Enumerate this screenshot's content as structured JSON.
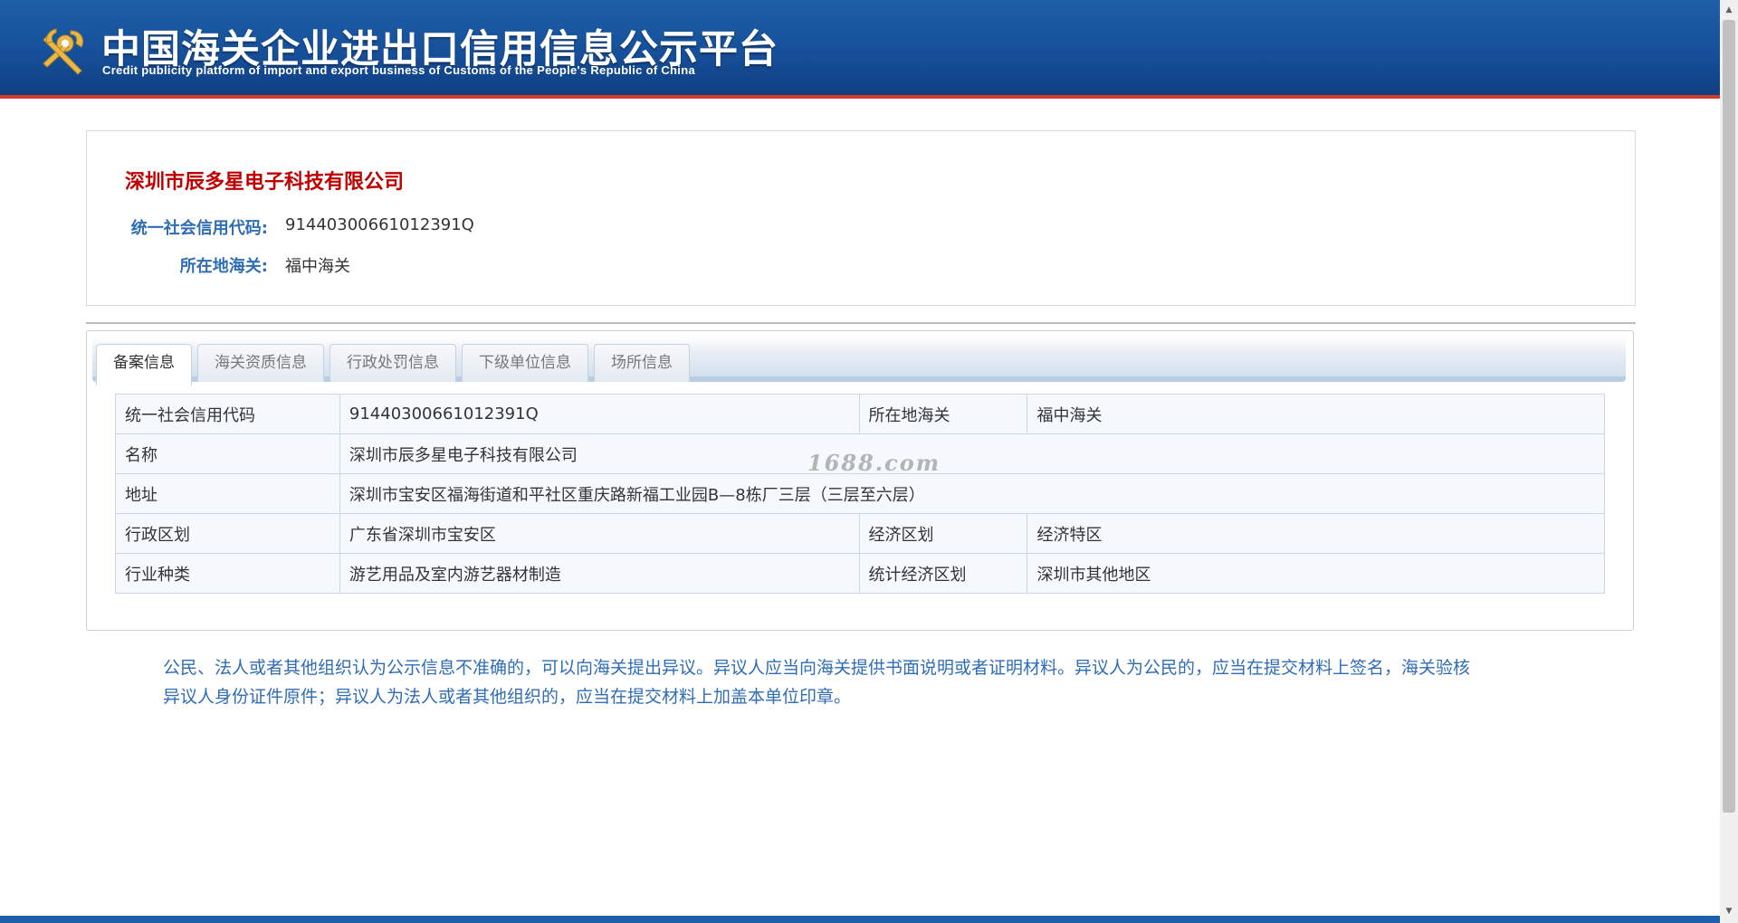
{
  "header": {
    "title": "中国海关企业进出口信用信息公示平台",
    "subtitle": "Credit publicity platform of import and export business of Customs of the People's Republic of China"
  },
  "company": {
    "name": "深圳市辰多星电子科技有限公司",
    "credit_code_label": "统一社会信用代码:",
    "credit_code": "91440300661012391Q",
    "customs_label": "所在地海关:",
    "customs": "福中海关"
  },
  "tabs": [
    {
      "label": "备案信息",
      "active": true
    },
    {
      "label": "海关资质信息",
      "active": false
    },
    {
      "label": "行政处罚信息",
      "active": false
    },
    {
      "label": "下级单位信息",
      "active": false
    },
    {
      "label": "场所信息",
      "active": false
    }
  ],
  "table": {
    "row1": {
      "l1": "统一社会信用代码",
      "v1": "91440300661012391Q",
      "l2": "所在地海关",
      "v2": "福中海关"
    },
    "row2": {
      "l1": "名称",
      "v1": "深圳市辰多星电子科技有限公司"
    },
    "row3": {
      "l1": "地址",
      "v1": "深圳市宝安区福海街道和平社区重庆路新福工业园B—8栋厂三层（三层至六层）"
    },
    "row4": {
      "l1": "行政区划",
      "v1": "广东省深圳市宝安区",
      "l2": "经济区划",
      "v2": "经济特区"
    },
    "row5": {
      "l1": "行业种类",
      "v1": "游艺用品及室内游艺器材制造",
      "l2": "统计经济区划",
      "v2": "深圳市其他地区"
    }
  },
  "notice": {
    "line1": "公民、法人或者其他组织认为公示信息不准确的，可以向海关提出异议。异议人应当向海关提供书面说明或者证明材料。异议人为公民的，应当在提交材料上签名，海关验核",
    "line2": "异议人身份证件原件；异议人为法人或者其他组织的，应当在提交材料上加盖本单位印章。"
  },
  "watermark": "1688.com",
  "colors": {
    "header_blue": "#1d5fa8",
    "header_red_line": "#d23b2c",
    "company_name_red": "#c00000",
    "label_blue": "#2f6db5"
  }
}
